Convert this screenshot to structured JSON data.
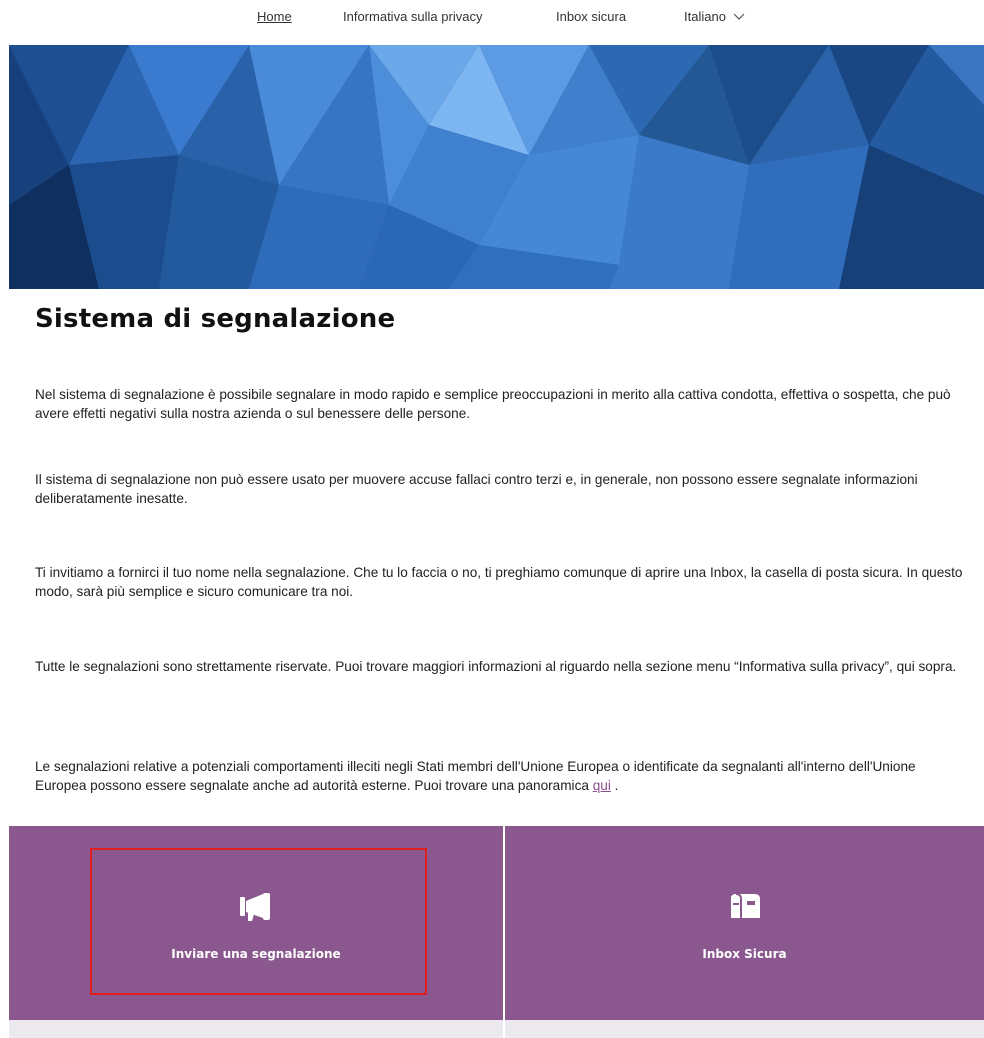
{
  "nav": {
    "home": "Home",
    "privacy": "Informativa sulla privacy",
    "inbox": "Inbox sicura",
    "language": "Italiano"
  },
  "page": {
    "title": "Sistema di segnalazione",
    "paragraphs": [
      "Nel sistema di segnalazione è possibile segnalare in modo rapido e semplice preoccupazioni in merito alla cattiva condotta, effettiva o sospetta, che può avere effetti negativi sulla nostra azienda o sul benessere delle persone.",
      "Il sistema di segnalazione non può essere usato per muovere accuse fallaci contro terzi e, in generale, non possono essere segnalate informazioni deliberatamente inesatte.",
      "Ti invitiamo a fornirci il tuo nome nella segnalazione. Che tu lo faccia o no, ti preghiamo comunque di aprire una Inbox, la casella di posta sicura. In questo modo, sarà più semplice e sicuro comunicare tra noi.",
      "Tutte le segnalazioni sono strettamente riservate. Puoi trovare maggiori informazioni al riguardo nella sezione menu “Informativa sulla privacy”, qui sopra.",
      "Le segnalazioni relative a potenziali comportamenti illeciti negli Stati membri dell'Unione Europea o identificate da segnalanti all'interno dell'Unione Europea possono essere segnalate anche ad autorità esterne. Puoi trovare una panoramica"
    ],
    "link_qui": "qui",
    "para5_end": " ."
  },
  "tiles": {
    "report": {
      "label": "Inviare una segnalazione",
      "icon": "megaphone-icon"
    },
    "inbox": {
      "label": "Inbox Sicura",
      "icon": "mailbox-icon"
    }
  },
  "colors": {
    "tile": "#8b578f",
    "link": "#8a4f8f",
    "highlight": "#e01e1e",
    "hero": "#2a6fc4"
  }
}
